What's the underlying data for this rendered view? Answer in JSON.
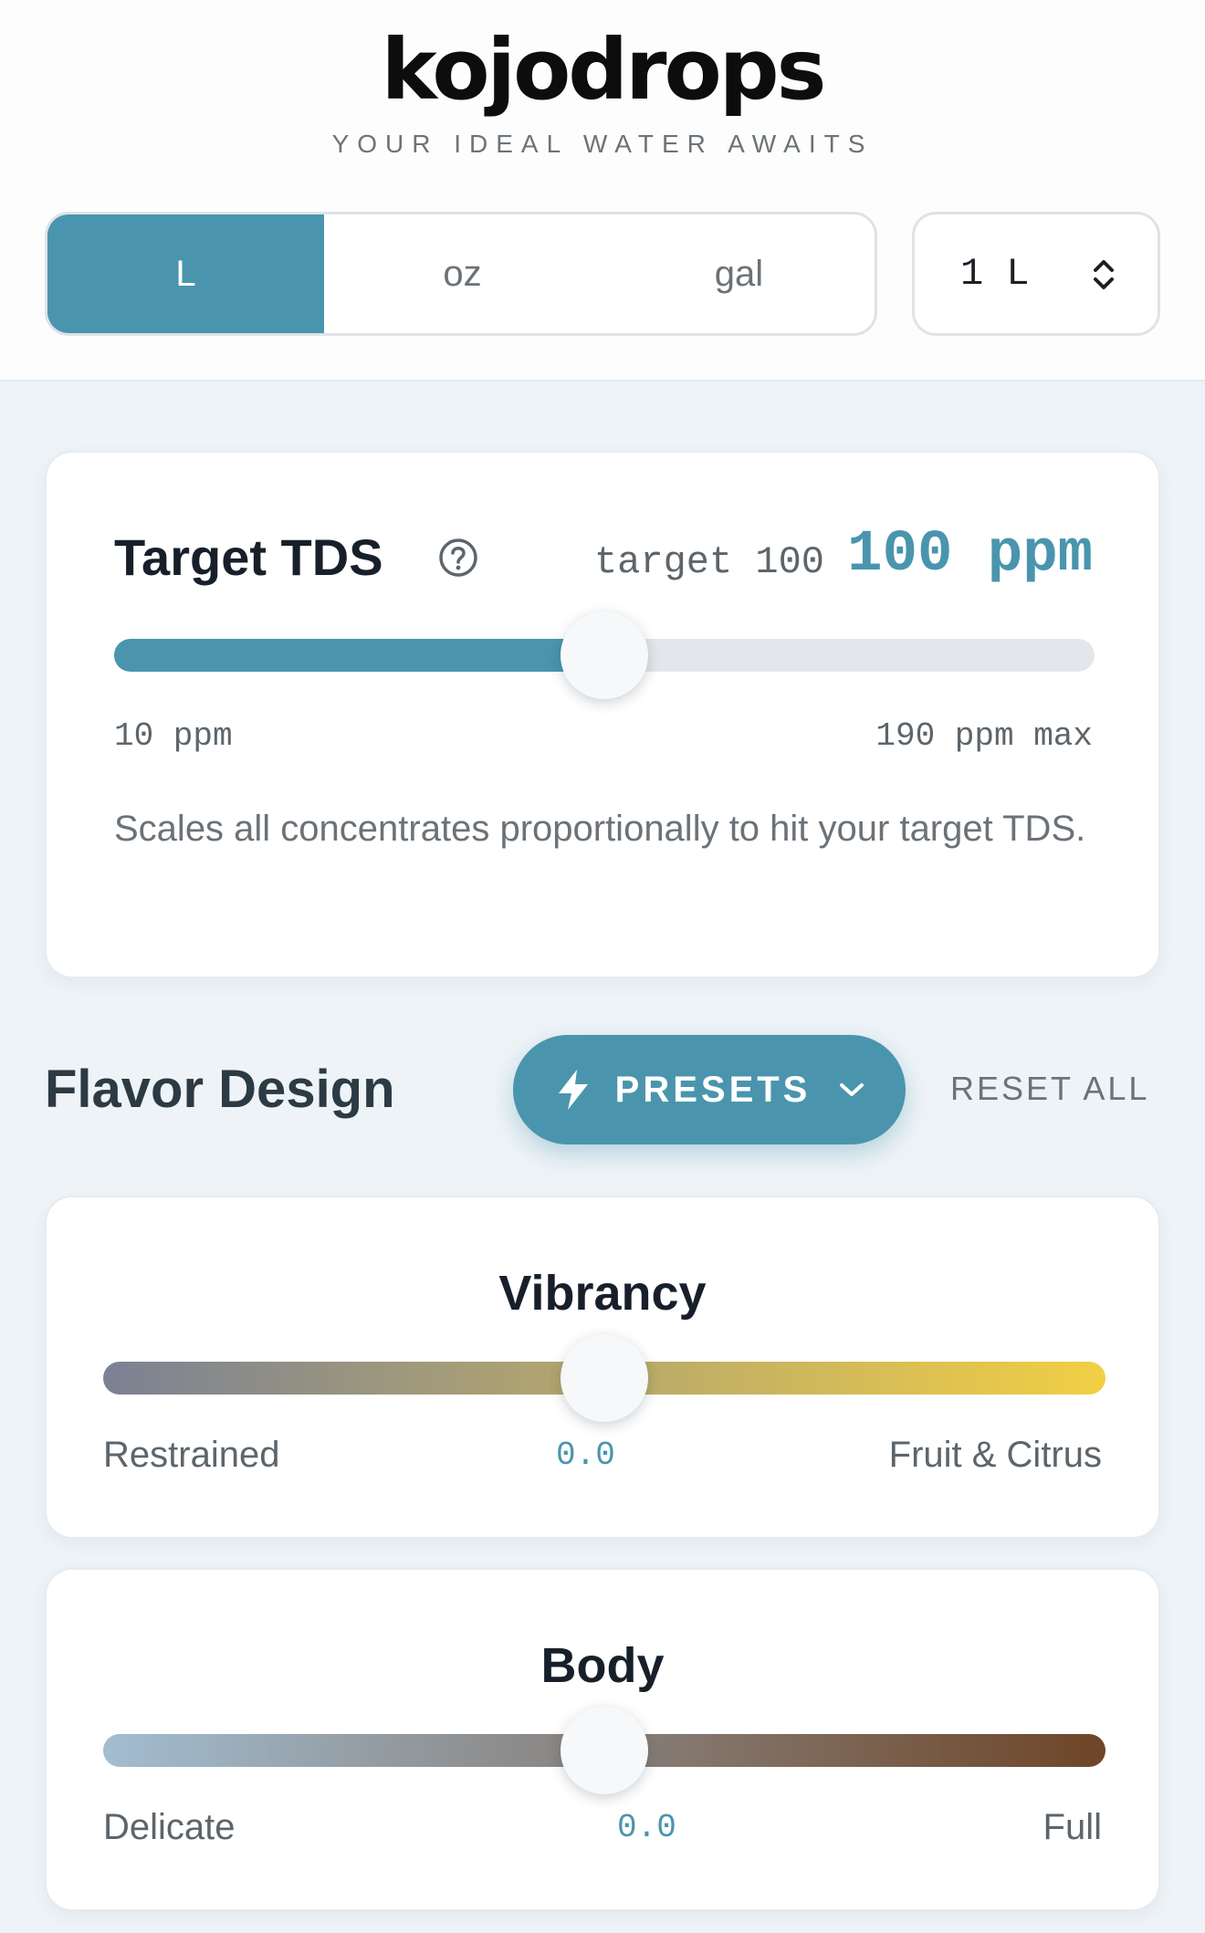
{
  "header": {
    "logo_text": "kojodrops",
    "tagline": "YOUR IDEAL WATER AWAITS",
    "units": [
      {
        "label": "L",
        "active": true
      },
      {
        "label": "oz",
        "active": false
      },
      {
        "label": "gal",
        "active": false
      }
    ],
    "volume": "1 L"
  },
  "tds": {
    "title": "Target TDS",
    "target_label": "target 100",
    "value_label": "100 ppm",
    "value": 100,
    "min": 10,
    "max": 190,
    "min_label": "10 ppm",
    "max_label": "190 ppm max",
    "description": "Scales all concentrates proportionally to hit your target TDS."
  },
  "flavor": {
    "title": "Flavor Design",
    "presets_label": "PRESETS",
    "reset_label": "RESET ALL",
    "sliders": [
      {
        "title": "Vibrancy",
        "left": "Restrained",
        "right": "Fruit & Citrus",
        "value": "0.0",
        "level": 0.5,
        "colors": [
          "#7b8194",
          "#f2cf44"
        ]
      },
      {
        "title": "Body",
        "left": "Delicate",
        "right": "Full",
        "value": "0.0",
        "level": 0.5,
        "colors": [
          "#a2bdd1",
          "#6e4527"
        ]
      }
    ]
  },
  "colors": {
    "accent": "#4a95ad",
    "background": "#eef3f7"
  }
}
